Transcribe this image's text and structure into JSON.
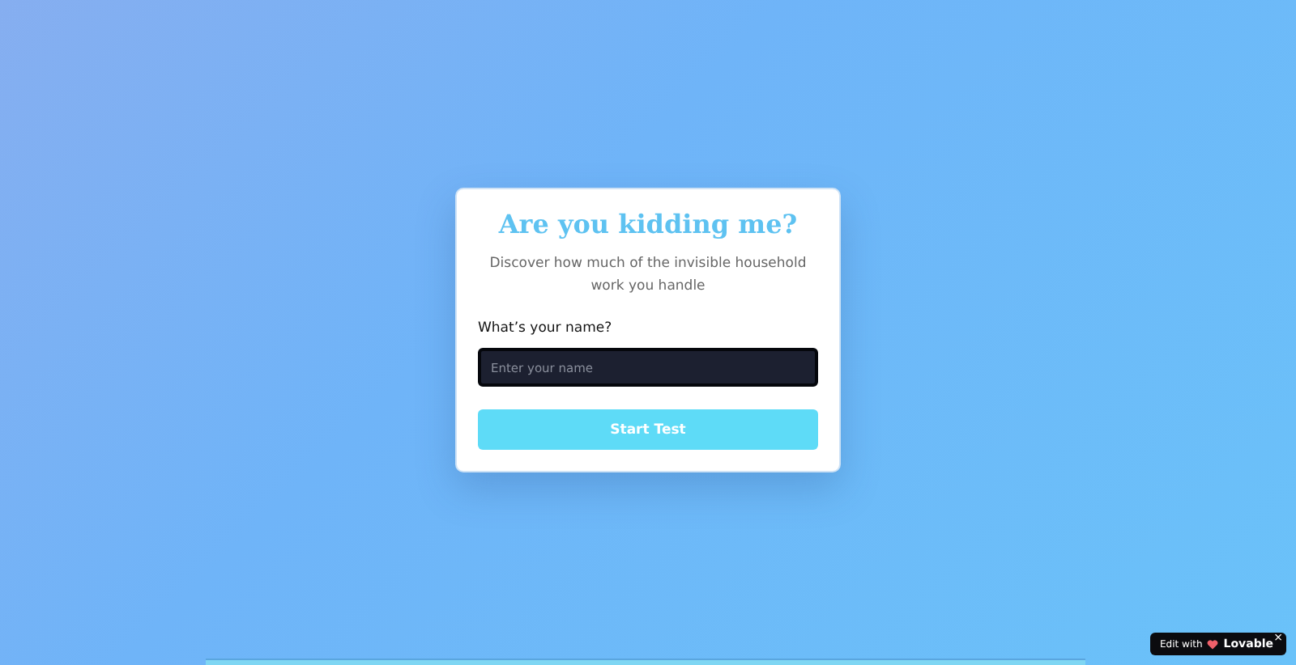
{
  "card": {
    "title": "Are you kidding me?",
    "subtitle": "Discover how much of the invisible household work you handle",
    "name_label": "What’s your name?",
    "name_field": {
      "placeholder": "Enter your name"
    },
    "start_button": "Start Test"
  },
  "badge": {
    "prefix": "Edit with",
    "brand": "Lovable",
    "close": "×"
  }
}
